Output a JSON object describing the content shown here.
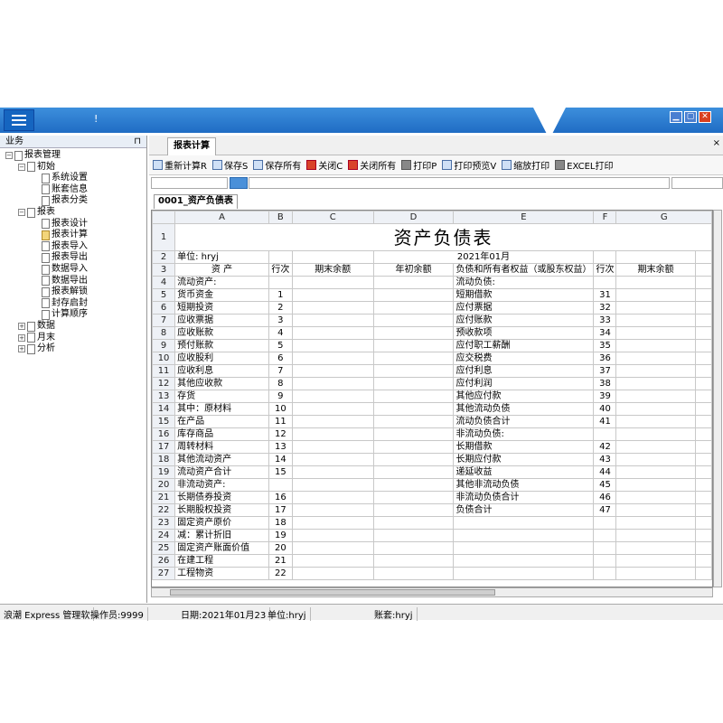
{
  "window": {
    "title": "!",
    "min": "▁",
    "max": "▢",
    "close": "✕"
  },
  "sidebar": {
    "title": "业务",
    "pin": "⊓",
    "items": [
      "报表管理",
      "初始",
      "系统设置",
      "账套信息",
      "报表分类",
      "报表",
      "报表设计",
      "报表计算",
      "报表导入",
      "报表导出",
      "数据导入",
      "数据导出",
      "报表解锁",
      "封存启封",
      "计算顺序",
      "数据",
      "月末",
      "分析"
    ]
  },
  "tabs": {
    "active": "报表计算",
    "close": "×"
  },
  "toolbar": [
    "重新计算R",
    "保存S",
    "保存所有",
    "关闭C",
    "关闭所有",
    "打印P",
    "打印预览V",
    "缩放打印",
    "EXCEL打印"
  ],
  "sheet_tab": "0001_资产负债表",
  "columns": [
    "A",
    "B",
    "C",
    "D",
    "E",
    "F",
    "G"
  ],
  "report": {
    "title": "资产负债表",
    "unit": "单位: hryj",
    "period": "2021年01月",
    "headers": [
      "资 产",
      "行次",
      "期末余额",
      "年初余额",
      "负债和所有者权益（或股东权益）",
      "行次",
      "期末余额"
    ]
  },
  "rows": [
    {
      "n": "4",
      "a": "流动资产:",
      "ai": 0,
      "b": "",
      "e": "流动负债:",
      "ei": 0,
      "f": ""
    },
    {
      "n": "5",
      "a": "货币资金",
      "ai": 1,
      "b": "1",
      "e": "短期借款",
      "ei": 1,
      "f": "31"
    },
    {
      "n": "6",
      "a": "短期投资",
      "ai": 1,
      "b": "2",
      "e": "应付票据",
      "ei": 1,
      "f": "32"
    },
    {
      "n": "7",
      "a": "应收票据",
      "ai": 1,
      "b": "3",
      "e": "应付账款",
      "ei": 1,
      "f": "33"
    },
    {
      "n": "8",
      "a": "应收账款",
      "ai": 1,
      "b": "4",
      "e": "预收款项",
      "ei": 1,
      "f": "34"
    },
    {
      "n": "9",
      "a": "预付账款",
      "ai": 1,
      "b": "5",
      "e": "应付职工薪酬",
      "ei": 1,
      "f": "35"
    },
    {
      "n": "10",
      "a": "应收股利",
      "ai": 1,
      "b": "6",
      "e": "应交税费",
      "ei": 1,
      "f": "36"
    },
    {
      "n": "11",
      "a": "应收利息",
      "ai": 1,
      "b": "7",
      "e": "应付利息",
      "ei": 1,
      "f": "37"
    },
    {
      "n": "12",
      "a": "其他应收款",
      "ai": 1,
      "b": "8",
      "e": "应付利润",
      "ei": 1,
      "f": "38"
    },
    {
      "n": "13",
      "a": "存货",
      "ai": 1,
      "b": "9",
      "e": "其他应付款",
      "ei": 1,
      "f": "39"
    },
    {
      "n": "14",
      "a": "其中：原材料",
      "ai": 1,
      "b": "10",
      "e": "其他流动负债",
      "ei": 1,
      "f": "40"
    },
    {
      "n": "15",
      "a": "在产品",
      "ai": 2,
      "b": "11",
      "e": "流动负债合计",
      "ei": 1,
      "f": "41"
    },
    {
      "n": "16",
      "a": "库存商品",
      "ai": 2,
      "b": "12",
      "e": "非流动负债:",
      "ei": 0,
      "f": ""
    },
    {
      "n": "17",
      "a": "周转材料",
      "ai": 2,
      "b": "13",
      "e": "长期借款",
      "ei": 1,
      "f": "42"
    },
    {
      "n": "18",
      "a": "其他流动资产",
      "ai": 1,
      "b": "14",
      "e": "长期应付款",
      "ei": 1,
      "f": "43"
    },
    {
      "n": "19",
      "a": "流动资产合计",
      "ai": 1,
      "b": "15",
      "e": "递延收益",
      "ei": 1,
      "f": "44"
    },
    {
      "n": "20",
      "a": "非流动资产:",
      "ai": 0,
      "b": "",
      "e": "其他非流动负债",
      "ei": 1,
      "f": "45"
    },
    {
      "n": "21",
      "a": "长期债券投资",
      "ai": 1,
      "b": "16",
      "e": "非流动负债合计",
      "ei": 1,
      "f": "46"
    },
    {
      "n": "22",
      "a": "长期股权投资",
      "ai": 1,
      "b": "17",
      "e": "负债合计",
      "ei": 1,
      "f": "47"
    },
    {
      "n": "23",
      "a": "固定资产原价",
      "ai": 1,
      "b": "18",
      "e": "",
      "ei": 0,
      "f": ""
    },
    {
      "n": "24",
      "a": "减：累计折旧",
      "ai": 1,
      "b": "19",
      "e": "",
      "ei": 0,
      "f": ""
    },
    {
      "n": "25",
      "a": "固定资产账面价值",
      "ai": 1,
      "b": "20",
      "e": "",
      "ei": 0,
      "f": ""
    },
    {
      "n": "26",
      "a": "在建工程",
      "ai": 1,
      "b": "21",
      "e": "",
      "ei": 0,
      "f": ""
    },
    {
      "n": "27",
      "a": "工程物资",
      "ai": 1,
      "b": "22",
      "e": "",
      "ei": 0,
      "f": ""
    }
  ],
  "status": {
    "app": "浪潮 Express 管理软",
    "operator": "操作员:9999",
    "date": "日期:2021年01月23",
    "unit": "单位:hryj",
    "book": "账套:hryj"
  }
}
